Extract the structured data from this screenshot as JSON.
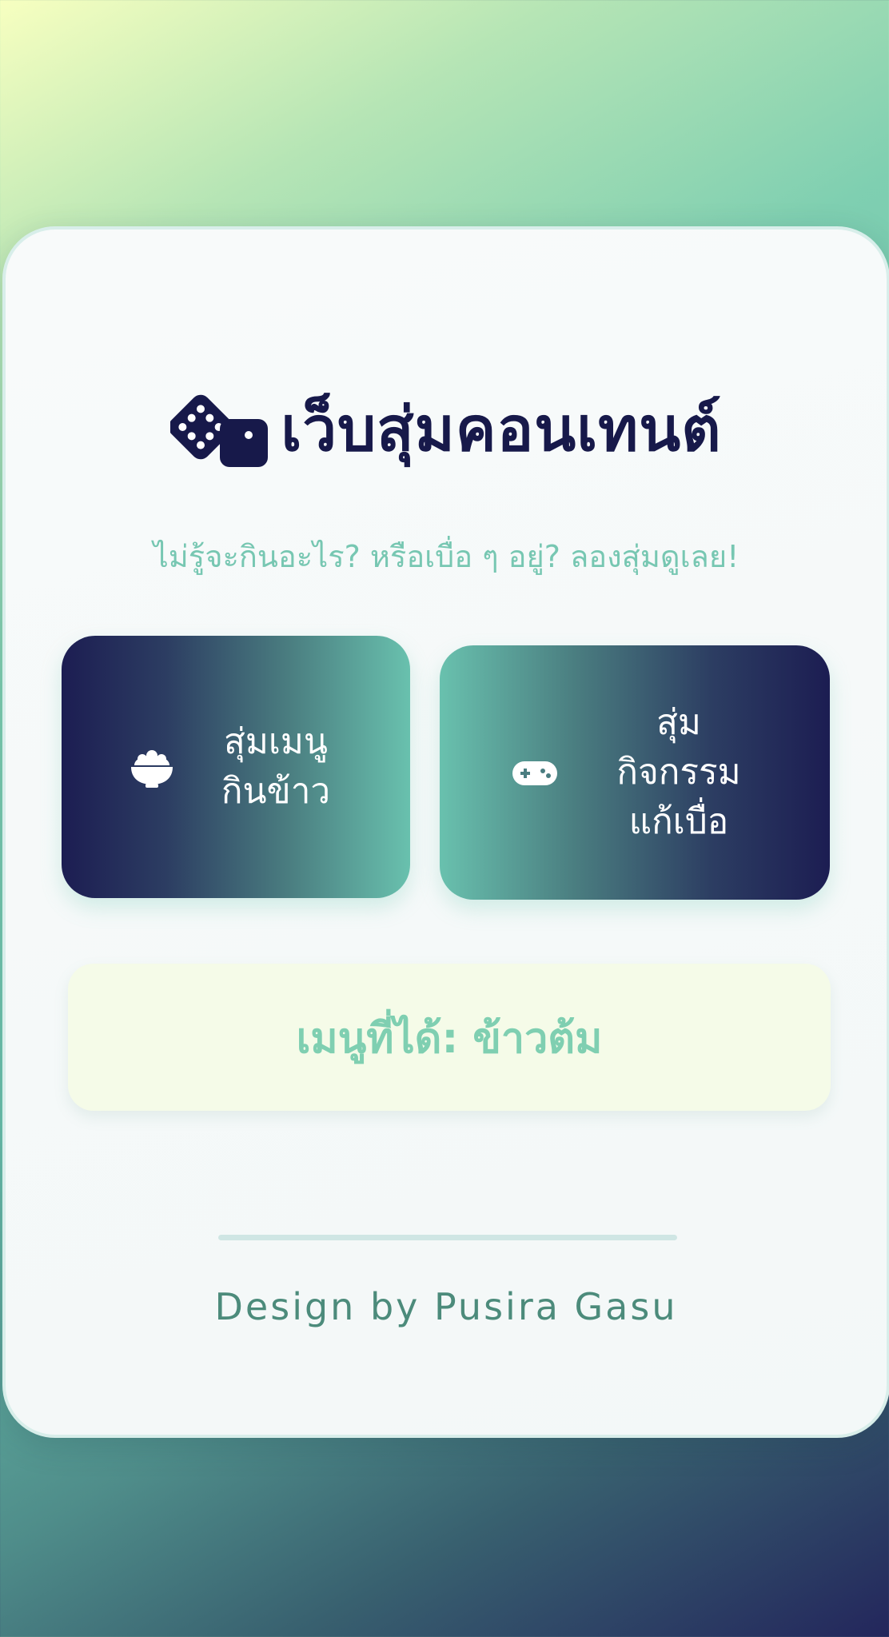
{
  "header": {
    "title": "เว็บสุ่มคอนเทนต์",
    "icon": "dice-icon",
    "subtitle": "ไม่รู้จะกินอะไร? หรือเบื่อ ๆ อยู่? ลองสุ่มดูเลย!"
  },
  "buttons": {
    "food": {
      "icon": "rice-bowl-icon",
      "line1": "สุ่มเมนู",
      "line2": "กินข้าว"
    },
    "activity": {
      "icon": "gamepad-icon",
      "line1": "สุ่ม",
      "line2": "กิจกรรม",
      "line3": "แก้เบื่อ"
    }
  },
  "result": {
    "text": "เมนูที่ได้: ข้าวต้ม"
  },
  "footer": {
    "credit": "Design by Pusira Gasu"
  },
  "colors": {
    "navy": "#17194a",
    "teal": "#69c1ae",
    "subtitle": "#77c7b2",
    "result_bg": "#f5fbe8",
    "footer": "#4c8b7b"
  }
}
